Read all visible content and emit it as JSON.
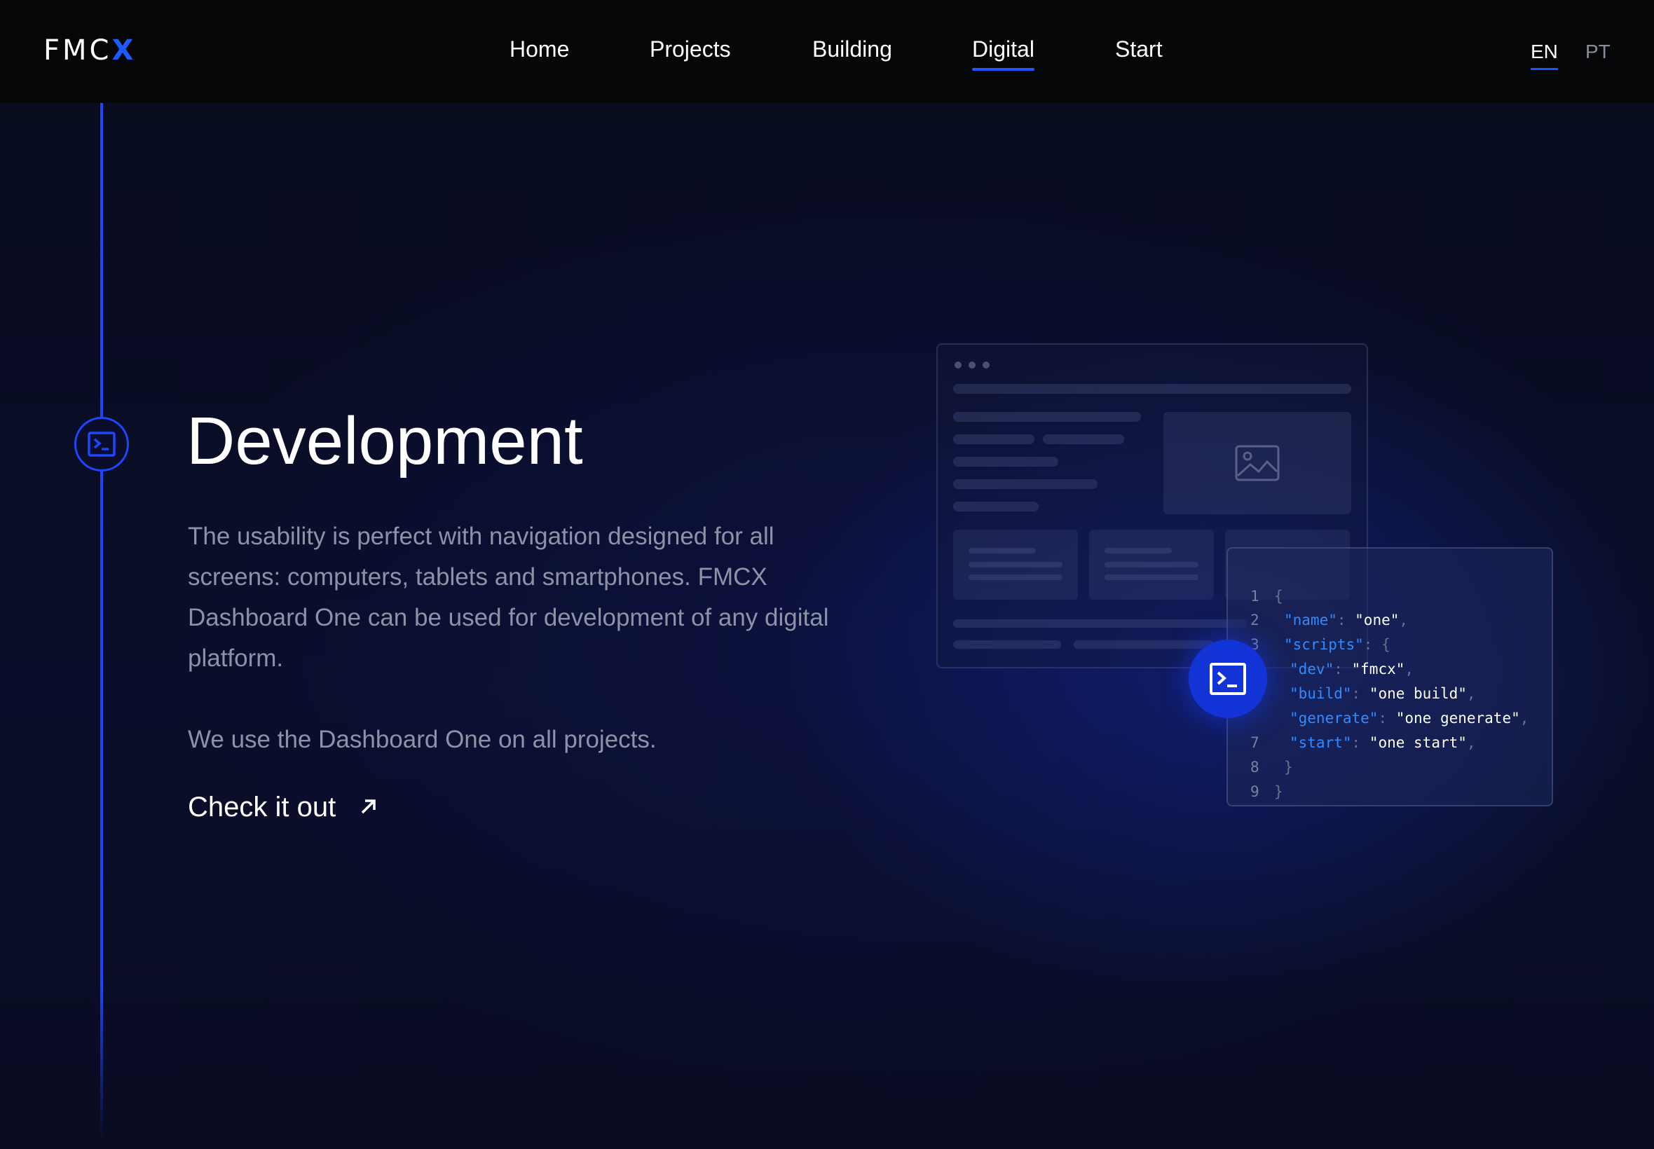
{
  "brand": {
    "logo_main": "FMC",
    "logo_accent": "X",
    "accent_color": "#1f55ff"
  },
  "nav": {
    "items": [
      {
        "label": "Home"
      },
      {
        "label": "Projects"
      },
      {
        "label": "Building"
      },
      {
        "label": "Digital",
        "active": true
      },
      {
        "label": "Start"
      }
    ]
  },
  "lang": {
    "en": "EN",
    "pt": "PT",
    "selected": "EN"
  },
  "section": {
    "icon": "terminal-icon",
    "title": "Development",
    "description": "The usability is perfect with navigation designed for all screens: computers, tablets and smartphones. FMCX Dashboard One can be used for development of any digital platform.",
    "note": "We use the Dashboard One on all projects.",
    "cta_label": "Check it out",
    "cta_icon": "arrow-up-right-icon"
  },
  "code": {
    "lines": [
      {
        "n": "1",
        "text": "{"
      },
      {
        "n": "2",
        "key": "\"name\"",
        "val": "\"one\""
      },
      {
        "n": "3",
        "key": "\"scripts\"",
        "val": "{"
      },
      {
        "n": "",
        "key": "\"dev\"",
        "val": "\"fmcx\""
      },
      {
        "n": "",
        "key": "\"build\"",
        "val": "\"one build\""
      },
      {
        "n": "",
        "key": "\"generate\"",
        "val": "\"one generate\""
      },
      {
        "n": "7",
        "key": "\"start\"",
        "val": "\"one start\""
      },
      {
        "n": "8",
        "text": "}"
      },
      {
        "n": "9",
        "text": "}"
      }
    ]
  }
}
